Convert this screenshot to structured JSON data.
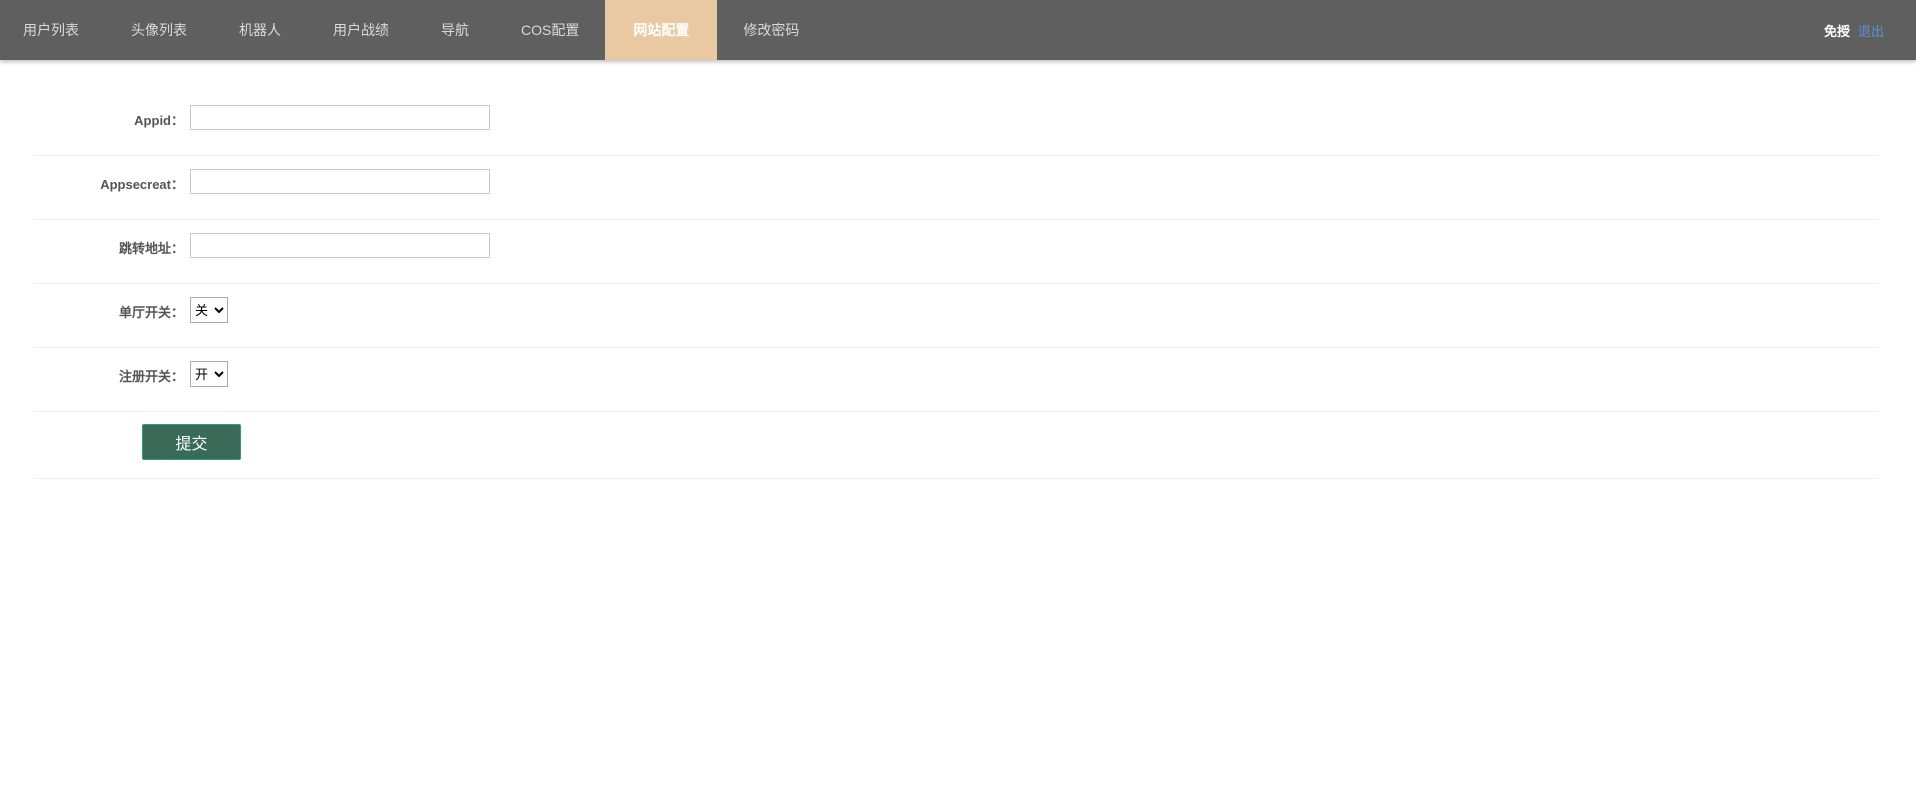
{
  "nav": {
    "items": [
      {
        "label": "用户列表",
        "active": false
      },
      {
        "label": "头像列表",
        "active": false
      },
      {
        "label": "机器人",
        "active": false
      },
      {
        "label": "用户战绩",
        "active": false
      },
      {
        "label": "导航",
        "active": false
      },
      {
        "label": "COS配置",
        "active": false
      },
      {
        "label": "网站配置",
        "active": true
      },
      {
        "label": "修改密码",
        "active": false
      }
    ],
    "active_color": "#e8c9a1",
    "bar_color": "#5f5f5f"
  },
  "user": {
    "name": "免授",
    "logout_label": "退出"
  },
  "form": {
    "appid": {
      "label": "Appid：",
      "value": ""
    },
    "appsecret": {
      "label": "Appsecreat：",
      "value": ""
    },
    "redirect": {
      "label": "跳转地址：",
      "value": ""
    },
    "single_hall": {
      "label": "单厅开关：",
      "selected": "关",
      "options": [
        "关",
        "开"
      ]
    },
    "register": {
      "label": "注册开关：",
      "selected": "开",
      "options": [
        "开",
        "关"
      ]
    },
    "submit_label": "提交"
  },
  "colors": {
    "submit_bg": "#3a6b58",
    "logout_link": "#5b8fd8"
  }
}
